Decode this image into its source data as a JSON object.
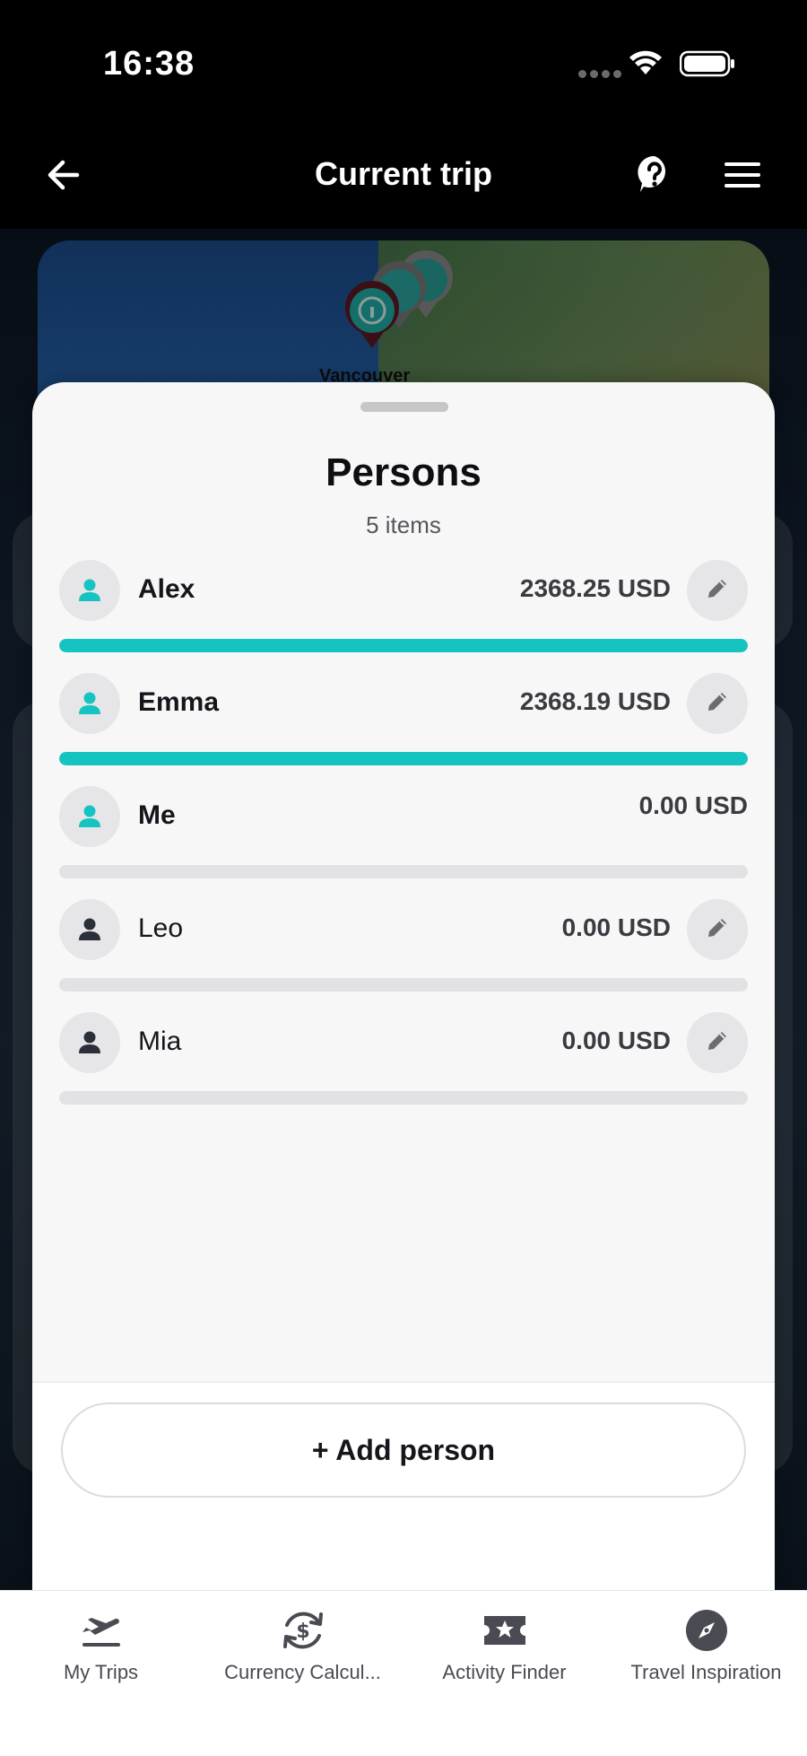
{
  "status": {
    "time": "16:38"
  },
  "header": {
    "title": "Current trip"
  },
  "map": {
    "city_label": "Vancouver"
  },
  "sheet": {
    "title": "Persons",
    "subtitle": "5 items",
    "persons": [
      {
        "name": "Alex",
        "amount": "2368.25 USD",
        "share": 1.0,
        "highlighted": true,
        "editable": true
      },
      {
        "name": "Emma",
        "amount": "2368.19 USD",
        "share": 1.0,
        "highlighted": true,
        "editable": true
      },
      {
        "name": "Me",
        "amount": "0.00 USD",
        "share": 0.0,
        "highlighted": true,
        "editable": false
      },
      {
        "name": "Leo",
        "amount": "0.00 USD",
        "share": 0.0,
        "highlighted": false,
        "editable": true
      },
      {
        "name": "Mia",
        "amount": "0.00 USD",
        "share": 0.0,
        "highlighted": false,
        "editable": true
      }
    ],
    "add_button": "+ Add person"
  },
  "tabs": [
    {
      "label": "My Trips",
      "icon": "plane-departure-icon"
    },
    {
      "label": "Currency Calcul...",
      "icon": "currency-exchange-icon"
    },
    {
      "label": "Activity Finder",
      "icon": "ticket-star-icon"
    },
    {
      "label": "Travel Inspiration",
      "icon": "compass-icon"
    }
  ],
  "colors": {
    "accent": "#15c4c0",
    "header_bg": "#000000",
    "sheet_bg": "#f7f7f8"
  }
}
